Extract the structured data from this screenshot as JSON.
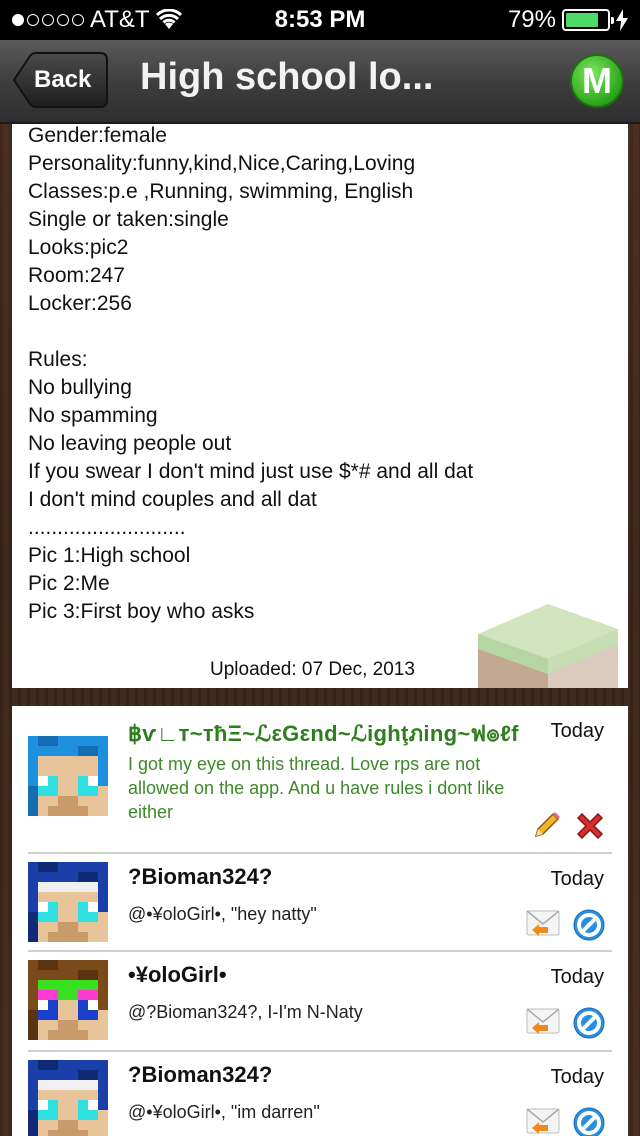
{
  "status_bar": {
    "carrier": "AT&T",
    "time": "8:53 PM",
    "battery_percent": "79%",
    "signal_bars_filled": 1,
    "battery_level": 0.79,
    "battery_color": "#4cd964"
  },
  "nav": {
    "back_label": "Back",
    "title": "High school lo...",
    "menu_icon_letter": "M",
    "menu_icon_color": "#2aa418"
  },
  "post": {
    "lines": [
      "Gender:female",
      "Personality:funny,kind,Nice,Caring,Loving",
      "Classes:p.e ,Running, swimming, English",
      "Single or taken:single",
      "Looks:pic2",
      "Room:247",
      "Locker:256",
      "",
      "Rules:",
      "No bullying",
      "No spamming",
      "No leaving people out",
      "If you swear I don't mind just use $*# and all dat",
      "I don't mind couples and all dat",
      "...........................",
      "Pic 1:High school",
      "Pic 2:Me",
      "Pic 3:First boy who asks"
    ],
    "uploaded": "Uploaded: 07 Dec, 2013"
  },
  "comments": [
    {
      "username": "฿ѵ∟т~тħΞ~ℒεGεnd~ℒighţภing~ฟ๏ℓf",
      "time": "Today",
      "text": "I got my eye on this thread. Love rps are not allowed on the app. And u have rules i dont like either",
      "highlight": true,
      "actions": [
        "edit-icon",
        "delete-icon"
      ]
    },
    {
      "username": "?Bioman324?",
      "time": "Today",
      "text": "@•¥oloGirl•, \"hey natty\"",
      "highlight": false,
      "actions": [
        "reply-icon",
        "block-icon"
      ]
    },
    {
      "username": "•¥oloGirl•",
      "time": "Today",
      "text": "@?Bioman324?, I-I'm N-Naty",
      "highlight": false,
      "actions": [
        "reply-icon",
        "block-icon"
      ]
    },
    {
      "username": "?Bioman324?",
      "time": "Today",
      "text": "@•¥oloGirl•, \"im darren\"",
      "highlight": false,
      "actions": [
        "reply-icon",
        "block-icon"
      ]
    }
  ]
}
